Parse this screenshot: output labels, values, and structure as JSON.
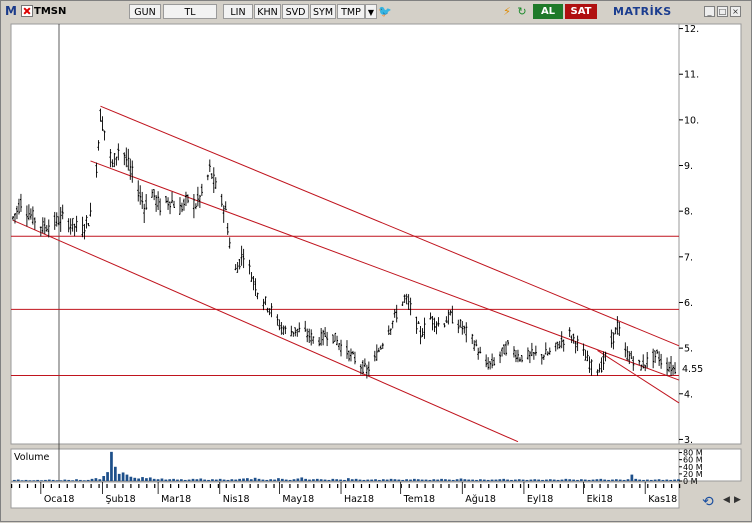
{
  "toolbar": {
    "logo": "M",
    "symbol": "TMSN",
    "period": "GUN",
    "currency": "TL",
    "scale": "LIN",
    "buttons": [
      "KHN",
      "SVD",
      "SYM",
      "TMP"
    ],
    "buy_label": "AL",
    "sell_label": "SAT",
    "brand": "MATRİKS",
    "icons": [
      "twitter-bird-icon",
      "lightning-icon",
      "refresh-icon"
    ]
  },
  "colors": {
    "price": "#000000",
    "channel": "#c0141e",
    "volume": "#1d4f8a",
    "background": "#ffffff"
  },
  "chart_data": [
    {
      "type": "candlestick",
      "title": "",
      "x_tick_labels": [
        "Oca18",
        "Şub18",
        "Mar18",
        "Nis18",
        "May18",
        "Haz18",
        "Tem18",
        "Ağu18",
        "Eyl18",
        "Eki18",
        "Kas18"
      ],
      "y_tick_labels": [
        "3.",
        "4.",
        "5.",
        "6.",
        "7.",
        "8.",
        "9.",
        "10.",
        "11.",
        "12."
      ],
      "ylim": [
        2.9,
        12.1
      ],
      "last_value_label": "4.55",
      "grid": false,
      "price_path": [
        [
          "2017-12-18",
          7.85
        ],
        [
          "2017-12-22",
          8.2
        ],
        [
          "2017-12-27",
          7.9
        ],
        [
          "2018-01-02",
          7.65
        ],
        [
          "2018-01-08",
          7.75
        ],
        [
          "2018-01-12",
          7.85
        ],
        [
          "2018-01-17",
          7.7
        ],
        [
          "2018-01-22",
          7.6
        ],
        [
          "2018-01-26",
          7.9
        ],
        [
          "2018-01-29",
          9.0
        ],
        [
          "2018-01-31",
          10.1
        ],
        [
          "2018-02-03",
          9.6
        ],
        [
          "2018-02-06",
          9.0
        ],
        [
          "2018-02-10",
          9.5
        ],
        [
          "2018-02-14",
          9.0
        ],
        [
          "2018-02-18",
          8.6
        ],
        [
          "2018-02-22",
          8.1
        ],
        [
          "2018-02-26",
          8.4
        ],
        [
          "2018-03-02",
          8.1
        ],
        [
          "2018-03-07",
          8.25
        ],
        [
          "2018-03-12",
          8.05
        ],
        [
          "2018-03-16",
          8.25
        ],
        [
          "2018-03-20",
          8.15
        ],
        [
          "2018-03-24",
          8.45
        ],
        [
          "2018-03-27",
          8.9
        ],
        [
          "2018-03-31",
          8.4
        ],
        [
          "2018-04-04",
          8.0
        ],
        [
          "2018-04-06",
          7.3
        ],
        [
          "2018-04-09",
          6.7
        ],
        [
          "2018-04-13",
          7.1
        ],
        [
          "2018-04-17",
          6.6
        ],
        [
          "2018-04-21",
          6.15
        ],
        [
          "2018-04-26",
          5.9
        ],
        [
          "2018-05-01",
          5.5
        ],
        [
          "2018-05-05",
          5.35
        ],
        [
          "2018-05-10",
          5.4
        ],
        [
          "2018-05-15",
          5.3
        ],
        [
          "2018-05-20",
          5.15
        ],
        [
          "2018-05-26",
          5.35
        ],
        [
          "2018-06-01",
          5.05
        ],
        [
          "2018-06-08",
          4.75
        ],
        [
          "2018-06-14",
          4.5
        ],
        [
          "2018-06-18",
          4.75
        ],
        [
          "2018-06-23",
          5.25
        ],
        [
          "2018-06-29",
          5.75
        ],
        [
          "2018-07-03",
          6.1
        ],
        [
          "2018-07-07",
          5.8
        ],
        [
          "2018-07-11",
          5.3
        ],
        [
          "2018-07-16",
          5.65
        ],
        [
          "2018-07-21",
          5.5
        ],
        [
          "2018-07-26",
          5.7
        ],
        [
          "2018-07-31",
          5.5
        ],
        [
          "2018-08-04",
          5.3
        ],
        [
          "2018-08-08",
          5.05
        ],
        [
          "2018-08-12",
          4.65
        ],
        [
          "2018-08-16",
          4.65
        ],
        [
          "2018-08-20",
          4.85
        ],
        [
          "2018-08-24",
          5.05
        ],
        [
          "2018-08-30",
          4.8
        ],
        [
          "2018-09-05",
          4.85
        ],
        [
          "2018-09-10",
          4.85
        ],
        [
          "2018-09-15",
          4.9
        ],
        [
          "2018-09-20",
          5.15
        ],
        [
          "2018-09-24",
          5.3
        ],
        [
          "2018-09-28",
          5.1
        ],
        [
          "2018-10-02",
          4.8
        ],
        [
          "2018-10-06",
          4.55
        ],
        [
          "2018-10-10",
          4.6
        ],
        [
          "2018-10-14",
          5.0
        ],
        [
          "2018-10-18",
          5.5
        ],
        [
          "2018-10-22",
          4.9
        ],
        [
          "2018-10-26",
          4.75
        ],
        [
          "2018-10-30",
          4.6
        ],
        [
          "2018-11-03",
          4.75
        ],
        [
          "2018-11-07",
          4.85
        ],
        [
          "2018-11-10",
          4.65
        ],
        [
          "2018-11-16",
          4.55
        ]
      ],
      "horizontal_lines": [
        7.45,
        5.85,
        4.4
      ],
      "trend_lines": [
        [
          [
            "2018-01-31",
            10.3
          ],
          [
            "2018-11-18",
            5.05
          ]
        ],
        [
          [
            "2018-01-26",
            9.1
          ],
          [
            "2018-11-18",
            4.3
          ]
        ],
        [
          [
            "2017-12-18",
            7.8
          ],
          [
            "2018-08-29",
            2.95
          ]
        ],
        [
          [
            "2018-10-08",
            4.95
          ],
          [
            "2018-11-18",
            3.8
          ]
        ]
      ]
    },
    {
      "type": "bar",
      "title": "Volume",
      "y_tick_labels": [
        "80 M",
        "60 M",
        "40 M",
        "20 M",
        "0 M"
      ],
      "ylim": [
        0,
        90
      ],
      "series": [
        {
          "values": [
            3,
            4,
            2,
            3,
            2,
            2,
            3,
            2,
            3,
            4,
            3,
            2,
            2,
            4,
            3,
            2,
            5,
            3,
            2,
            3,
            6,
            8,
            5,
            14,
            25,
            82,
            40,
            20,
            24,
            18,
            12,
            9,
            7,
            11,
            8,
            10,
            6,
            5,
            7,
            4,
            5,
            6,
            4,
            5,
            3,
            4,
            6,
            5,
            7,
            4,
            3,
            5,
            4,
            6,
            4,
            3,
            5,
            4,
            6,
            7,
            8,
            5,
            9,
            6,
            4,
            3,
            5,
            4,
            8,
            6,
            4,
            3,
            5,
            7,
            10,
            6,
            4,
            5,
            6,
            5,
            4,
            3,
            6,
            5,
            4,
            3,
            8,
            5,
            6,
            4,
            3,
            4,
            4,
            5,
            3,
            5,
            4,
            6,
            5,
            4,
            3,
            5,
            4,
            6,
            5,
            4,
            4,
            3,
            5,
            4,
            6,
            5,
            4,
            3,
            5,
            7,
            5,
            4,
            4,
            3,
            5,
            4,
            3,
            4,
            4,
            5,
            6,
            4,
            3,
            4,
            5,
            4,
            3,
            4,
            5,
            4,
            3,
            4,
            5,
            4,
            3,
            4,
            6,
            5,
            4,
            3,
            5,
            4,
            3,
            4,
            5,
            6,
            4,
            3,
            4,
            5,
            4,
            3,
            5,
            18,
            6,
            4,
            3,
            4,
            3,
            4,
            5,
            3,
            4,
            3,
            4,
            5
          ]
        }
      ]
    }
  ]
}
